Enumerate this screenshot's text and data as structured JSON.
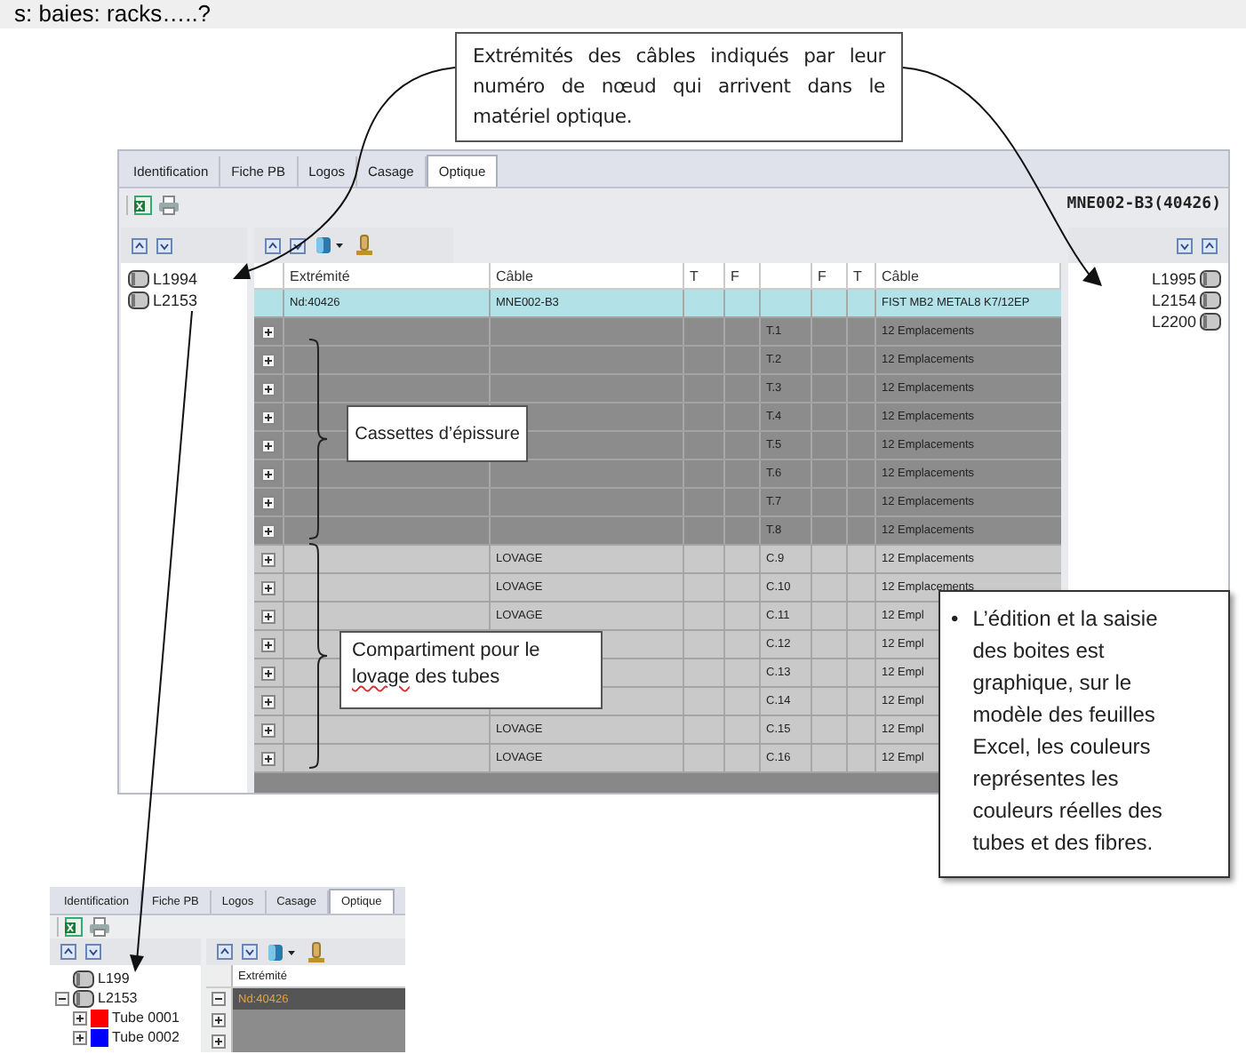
{
  "heading": "s: baies: racks…..?",
  "cable_end_callout": "Extrémités des câbles indiqués par leur numéro de nœud qui arrivent dans le matériel optique.",
  "main_window": {
    "tabs": [
      {
        "label": "Identification",
        "selected": false
      },
      {
        "label": "Fiche PB",
        "selected": false
      },
      {
        "label": "Logos",
        "selected": false
      },
      {
        "label": "Casage",
        "selected": false
      },
      {
        "label": "Optique",
        "selected": true
      }
    ],
    "box_name": "MNE002-B3(40426)",
    "left_cables": [
      {
        "label": "L1994"
      },
      {
        "label": "L2153"
      }
    ],
    "right_cables": [
      {
        "label": "L1995"
      },
      {
        "label": "L2154"
      },
      {
        "label": "L2200"
      }
    ],
    "grid": {
      "columns": [
        {},
        {
          "label": "Extrémité"
        },
        {
          "label": "Câble"
        },
        {
          "label": "T"
        },
        {
          "label": "F"
        },
        {},
        {
          "label": "F"
        },
        {
          "label": "T"
        },
        {
          "label": "Câble"
        }
      ],
      "rows": [
        {
          "kind": "node",
          "end": "Nd:40426",
          "cable": "MNE002-B3",
          "far_cable": "FIST MB2 METAL8 K7/12EP"
        },
        {
          "kind": "cassette",
          "expanded": false,
          "slot": "T.1",
          "far_cable": "12 Emplacements"
        },
        {
          "kind": "cassette",
          "expanded": false,
          "slot": "T.2",
          "far_cable": "12 Emplacements"
        },
        {
          "kind": "cassette",
          "expanded": false,
          "slot": "T.3",
          "far_cable": "12 Emplacements"
        },
        {
          "kind": "cassette",
          "expanded": false,
          "slot": "T.4",
          "far_cable": "12 Emplacements"
        },
        {
          "kind": "cassette",
          "expanded": false,
          "slot": "T.5",
          "far_cable": "12 Emplacements"
        },
        {
          "kind": "cassette",
          "expanded": false,
          "slot": "T.6",
          "far_cable": "12 Emplacements"
        },
        {
          "kind": "cassette",
          "expanded": false,
          "slot": "T.7",
          "far_cable": "12 Emplacements"
        },
        {
          "kind": "cassette",
          "expanded": false,
          "slot": "T.8",
          "far_cable": "12 Emplacements"
        },
        {
          "kind": "lovage",
          "expanded": false,
          "cable": "LOVAGE",
          "slot": "C.9",
          "far_cable": "12 Emplacements"
        },
        {
          "kind": "lovage",
          "expanded": false,
          "cable": "LOVAGE",
          "slot": "C.10",
          "far_cable": "12 Emplacements"
        },
        {
          "kind": "lovage",
          "expanded": false,
          "cable": "LOVAGE",
          "slot": "C.11",
          "far_cable": "12 Empl"
        },
        {
          "kind": "lovage",
          "expanded": false,
          "slot": "C.12",
          "far_cable": "12 Empl"
        },
        {
          "kind": "lovage",
          "expanded": false,
          "slot": "C.13",
          "far_cable": "12 Empl"
        },
        {
          "kind": "lovage",
          "expanded": false,
          "slot": "C.14",
          "far_cable": "12 Empl"
        },
        {
          "kind": "lovage",
          "expanded": false,
          "cable": "LOVAGE",
          "slot": "C.15",
          "far_cable": "12 Empl"
        },
        {
          "kind": "lovage",
          "expanded": false,
          "cable": "LOVAGE",
          "slot": "C.16",
          "far_cable": "12 Empl"
        }
      ]
    },
    "cassette_callout": "Cassettes d’épissure",
    "lovage_callout": "Compartiment  pour le **lovage** des tubes"
  },
  "note_callout": {
    "bullet": "•",
    "text": "L’édition et la saisie des boites est graphique, sur le modèle des feuilles Excel, les couleurs représentes les couleurs réelles des tubes et des fibres."
  },
  "mini_window": {
    "tabs": [
      {
        "label": "Identification",
        "selected": false
      },
      {
        "label": "Fiche PB",
        "selected": false
      },
      {
        "label": "Logos",
        "selected": false
      },
      {
        "label": "Casage",
        "selected": false
      },
      {
        "label": "Optique",
        "selected": true
      }
    ],
    "tree": [
      {
        "label": "L199"
      },
      {
        "label": "L2153",
        "expanded": true,
        "children": [
          {
            "label": "Tube 0001",
            "color": "#ff0000",
            "expanded": false
          },
          {
            "label": "Tube 0002",
            "color": "#0000ff",
            "expanded": false
          }
        ]
      }
    ],
    "grid_header": "Extrémité",
    "rows": [
      {
        "kind": "node",
        "expanded": true,
        "end": "Nd:40426"
      },
      {
        "kind": "cassette",
        "expanded": false
      },
      {
        "kind": "cassette",
        "expanded": false
      }
    ]
  }
}
